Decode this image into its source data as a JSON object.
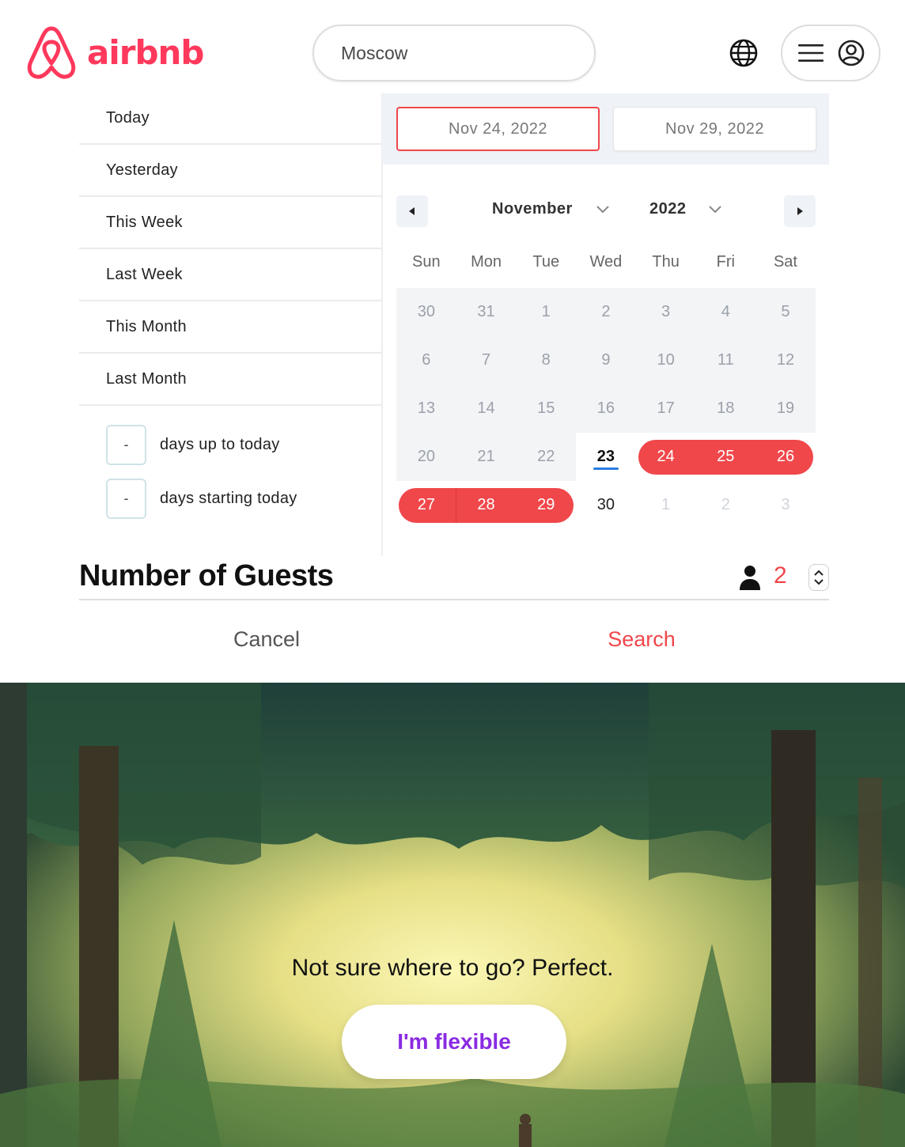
{
  "header": {
    "brand": "airbnb",
    "search_value": "Moscow",
    "brand_color": "#ff385c"
  },
  "presets": {
    "items": [
      "Today",
      "Yesterday",
      "This Week",
      "Last Week",
      "This Month",
      "Last Month"
    ],
    "range_inputs": [
      {
        "value": "-",
        "label": "days up to today"
      },
      {
        "value": "-",
        "label": "days starting today"
      }
    ]
  },
  "calendar": {
    "start_date": "Nov 24, 2022",
    "end_date": "Nov 29, 2022",
    "month": "November",
    "year": "2022",
    "weekdays": [
      "Sun",
      "Mon",
      "Tue",
      "Wed",
      "Thu",
      "Fri",
      "Sat"
    ],
    "weeks": [
      [
        "30",
        "31",
        "1",
        "2",
        "3",
        "4",
        "5"
      ],
      [
        "6",
        "7",
        "8",
        "9",
        "10",
        "11",
        "12"
      ],
      [
        "13",
        "14",
        "15",
        "16",
        "17",
        "18",
        "19"
      ],
      [
        "20",
        "21",
        "22",
        "23",
        "24",
        "25",
        "26"
      ],
      [
        "27",
        "28",
        "29",
        "30",
        "1",
        "2",
        "3"
      ]
    ],
    "today": "23",
    "selected": [
      "24",
      "25",
      "26",
      "27",
      "28",
      "29"
    ],
    "accent_color": "#f0474b"
  },
  "guests": {
    "title": "Number of Guests",
    "count": "2"
  },
  "actions": {
    "cancel": "Cancel",
    "search": "Search"
  },
  "hero": {
    "tagline": "Not sure where to go? Perfect.",
    "button": "I'm flexible",
    "button_color": "#8a2be2"
  }
}
